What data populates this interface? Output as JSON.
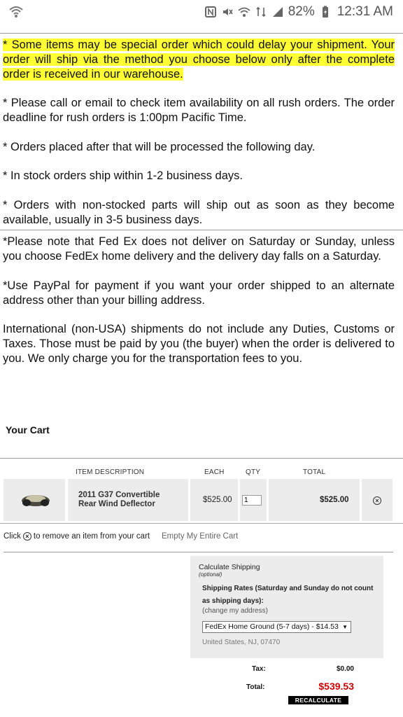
{
  "status_bar": {
    "battery": "82%",
    "time": "12:31 AM"
  },
  "notes": {
    "highlighted": "* Some items may be special order which could delay your shipment. Your order will ship via the method you choose below only after the complete order is received in our warehouse.",
    "rush": "* Please call or email to check item availability on all rush orders. The order deadline for rush orders is 1:00pm Pacific Time.",
    "after_deadline": "* Orders placed after that will be processed the following day.",
    "in_stock": "* In stock orders ship within 1-2 business days.",
    "non_stocked": "* Orders with non-stocked parts will ship out as soon as they become available, usually in 3-5 business days.",
    "fedex": "*Please note that Fed Ex does not deliver on Saturday or Sunday, unless you choose FedEx home delivery and the delivery day falls on a Saturday.",
    "paypal": "*Use PayPal for payment if you want your order shipped to an alternate address other than your billing address.",
    "international": "International (non-USA) shipments do not include any Duties, Customs or Taxes. Those must be paid by you (the buyer) when the order is delivered to you. We only charge you for the transportation fees to you."
  },
  "cart": {
    "title": "Your Cart",
    "headers": {
      "item_description": "ITEM  DESCRIPTION",
      "each": "EACH",
      "qty": "QTY",
      "total": "TOTAL"
    },
    "items": [
      {
        "description_line1": "2011 G37 Convertible",
        "description_line2": "Rear Wind Deflector",
        "each": "$525.00",
        "qty": "1",
        "total": "$525.00"
      }
    ],
    "remove_note_before": "Click",
    "remove_note_after": "to remove an item from your cart",
    "empty_cart": "Empty My Entire Cart"
  },
  "shipping": {
    "title": "Calculate Shipping",
    "optional": "(optional)",
    "rates_label": "Shipping Rates (Saturday and Sunday do not count as shipping days):",
    "change_address": "(change my address)",
    "selected_option": "FedEx Home Ground (5-7 days) - $14.53",
    "address": "United States, NJ, 07470"
  },
  "totals": {
    "tax_label": "Tax:",
    "tax_value": "$0.00",
    "total_label": "Total:",
    "total_value": "$539.53",
    "recalculate": "RECALCULATE"
  },
  "colors": {
    "highlight": "#ffff33",
    "total_red": "#cc0000",
    "row_bg": "#ececec"
  }
}
